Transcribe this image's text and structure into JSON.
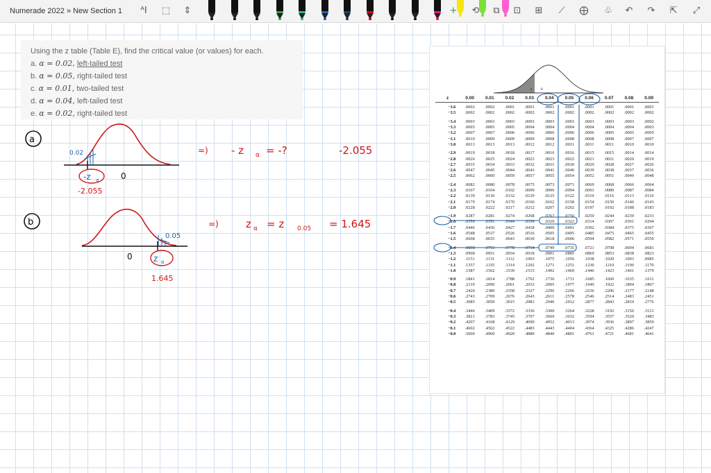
{
  "toolbar": {
    "breadcrumb": "Numerade 2022 » New Section 1",
    "tools": [
      "text-select-icon",
      "lasso-icon",
      "insert-space-icon",
      "eraser-icon",
      "plus-icon",
      "ink-to-shape-icon",
      "ink-to-text-icon",
      "ink-replay-icon",
      "ruler-icon",
      "math-icon",
      "tag-icon",
      "undo-icon",
      "redo-icon",
      "share-icon",
      "expand-icon"
    ],
    "pens": [
      {
        "name": "pen-black",
        "color": "#111111"
      },
      {
        "name": "pen-black-2",
        "color": "#111111"
      },
      {
        "name": "pen-black-3",
        "color": "#111111"
      },
      {
        "name": "pen-green",
        "color": "#2da44e"
      },
      {
        "name": "pen-teal",
        "color": "#1abc9c"
      },
      {
        "name": "pen-blue",
        "color": "#1f5fbf"
      },
      {
        "name": "pen-navy",
        "color": "#1d3f7a"
      },
      {
        "name": "pen-red",
        "color": "#d0021b"
      },
      {
        "name": "pen-black-4",
        "color": "#111111"
      },
      {
        "name": "pen-black-5",
        "color": "#111111"
      },
      {
        "name": "pen-magenta",
        "color": "#e6168b"
      },
      {
        "name": "pen-yellow-highlighter",
        "color": "#f5e50a"
      },
      {
        "name": "pen-green-highlighter",
        "color": "#7ddf3a"
      },
      {
        "name": "pen-pink-highlighter",
        "color": "#ff5dd0"
      }
    ]
  },
  "problem": {
    "intro": "Using the z table (Table E), find the critical value (or values) for each.",
    "items": [
      {
        "letter": "a.",
        "alpha": "α = 0.02,",
        "tail": "left-tailed test"
      },
      {
        "letter": "b.",
        "alpha": "α = 0.05,",
        "tail": "right-tailed test"
      },
      {
        "letter": "c.",
        "alpha": "α = 0.01,",
        "tail": "two-tailed test"
      },
      {
        "letter": "d.",
        "alpha": "α = 0.04,",
        "tail": "left-tailed test"
      },
      {
        "letter": "e.",
        "alpha": "α = 0.02,",
        "tail": "right-tailed test"
      }
    ]
  },
  "handwriting": {
    "part_a": {
      "label": "a",
      "tail_area": "0.02",
      "neg_z": "-z",
      "alpha_sub": "α",
      "zero": "0",
      "value_under": "-2.055",
      "arrow": "=)",
      "eq1": "- z",
      "eq1_tail": "= -?",
      "answer": "-2.055"
    },
    "part_b": {
      "label": "b",
      "tail_area": "0.05",
      "zero": "0",
      "z": "z",
      "alpha_sub": "α",
      "value_under": "1.645",
      "arrow": "=)",
      "eq": "z",
      "eq_mid": "= z",
      "sub_val": "0.05",
      "answer": "= 1.645"
    }
  },
  "ztable": {
    "curve_labels": [
      "z",
      "0"
    ],
    "headers": [
      "z",
      "0.00",
      "0.01",
      "0.02",
      "0.03",
      "0.04",
      "0.05",
      "0.06",
      "0.07",
      "0.08",
      "0.09"
    ],
    "groups": [
      [
        [
          "−3.6",
          ".0002",
          ".0002",
          ".0001",
          ".0001",
          ".0001",
          ".0001",
          ".0001",
          ".0001",
          ".0001",
          ".0001"
        ],
        [
          "−3.5",
          ".0002",
          ".0002",
          ".0002",
          ".0002",
          ".0002",
          ".0002",
          ".0002",
          ".0002",
          ".0002",
          ".0002"
        ]
      ],
      [
        [
          "−3.4",
          ".0003",
          ".0003",
          ".0003",
          ".0003",
          ".0003",
          ".0003",
          ".0003",
          ".0003",
          ".0003",
          ".0002"
        ],
        [
          "−3.3",
          ".0005",
          ".0005",
          ".0005",
          ".0004",
          ".0004",
          ".0004",
          ".0004",
          ".0004",
          ".0004",
          ".0003"
        ],
        [
          "−3.2",
          ".0007",
          ".0007",
          ".0006",
          ".0006",
          ".0006",
          ".0006",
          ".0006",
          ".0005",
          ".0005",
          ".0005"
        ],
        [
          "−3.1",
          ".0010",
          ".0009",
          ".0009",
          ".0009",
          ".0008",
          ".0008",
          ".0008",
          ".0008",
          ".0007",
          ".0007"
        ],
        [
          "−3.0",
          ".0013",
          ".0013",
          ".0013",
          ".0012",
          ".0012",
          ".0011",
          ".0011",
          ".0011",
          ".0010",
          ".0010"
        ]
      ],
      [
        [
          "−2.9",
          ".0019",
          ".0018",
          ".0018",
          ".0017",
          ".0016",
          ".0016",
          ".0015",
          ".0015",
          ".0014",
          ".0014"
        ],
        [
          "−2.8",
          ".0026",
          ".0025",
          ".0024",
          ".0023",
          ".0023",
          ".0022",
          ".0021",
          ".0021",
          ".0020",
          ".0019"
        ],
        [
          "−2.7",
          ".0035",
          ".0034",
          ".0033",
          ".0032",
          ".0031",
          ".0030",
          ".0029",
          ".0028",
          ".0027",
          ".0026"
        ],
        [
          "−2.6",
          ".0047",
          ".0045",
          ".0044",
          ".0043",
          ".0041",
          ".0040",
          ".0039",
          ".0038",
          ".0037",
          ".0036"
        ],
        [
          "−2.5",
          ".0062",
          ".0060",
          ".0059",
          ".0057",
          ".0055",
          ".0054",
          ".0052",
          ".0051",
          ".0049",
          ".0048"
        ]
      ],
      [
        [
          "−2.4",
          ".0082",
          ".0080",
          ".0078",
          ".0075",
          ".0073",
          ".0071",
          ".0069",
          ".0068",
          ".0066",
          ".0064"
        ],
        [
          "−2.3",
          ".0107",
          ".0104",
          ".0102",
          ".0099",
          ".0096",
          ".0094",
          ".0091",
          ".0089",
          ".0087",
          ".0084"
        ],
        [
          "−2.2",
          ".0139",
          ".0136",
          ".0132",
          ".0129",
          ".0125",
          ".0122",
          ".0119",
          ".0116",
          ".0113",
          ".0110"
        ],
        [
          "−2.1",
          ".0179",
          ".0174",
          ".0170",
          ".0166",
          ".0162",
          ".0158",
          ".0154",
          ".0150",
          ".0146",
          ".0143"
        ],
        [
          "−2.0",
          ".0228",
          ".0222",
          ".0217",
          ".0212",
          ".0207",
          ".0202",
          ".0197",
          ".0192",
          ".0188",
          ".0183"
        ]
      ],
      [
        [
          "−1.9",
          ".0287",
          ".0281",
          ".0274",
          ".0268",
          ".0262",
          ".0256",
          ".0250",
          ".0244",
          ".0239",
          ".0233"
        ],
        [
          "−1.8",
          ".0359",
          ".0351",
          ".0344",
          ".0336",
          ".0329",
          ".0322",
          ".0314",
          ".0307",
          ".0301",
          ".0294"
        ],
        [
          "−1.7",
          ".0446",
          ".0436",
          ".0427",
          ".0418",
          ".0409",
          ".0401",
          ".0392",
          ".0384",
          ".0375",
          ".0367"
        ],
        [
          "−1.6",
          ".0548",
          ".0537",
          ".0526",
          ".0516",
          ".0505",
          ".0495",
          ".0485",
          ".0475",
          ".0465",
          ".0455"
        ],
        [
          "−1.5",
          ".0668",
          ".0655",
          ".0643",
          ".0630",
          ".0618",
          ".0606",
          ".0594",
          ".0582",
          ".0571",
          ".0559"
        ]
      ],
      [
        [
          "−1.4",
          ".0808",
          ".0793",
          ".0778",
          ".0764",
          ".0749",
          ".0735",
          ".0721",
          ".0708",
          ".0694",
          ".0681"
        ],
        [
          "−1.3",
          ".0968",
          ".0951",
          ".0934",
          ".0918",
          ".0901",
          ".0885",
          ".0869",
          ".0853",
          ".0838",
          ".0823"
        ],
        [
          "−1.2",
          ".1151",
          ".1131",
          ".1112",
          ".1093",
          ".1075",
          ".1056",
          ".1038",
          ".1020",
          ".1003",
          ".0985"
        ],
        [
          "−1.1",
          ".1357",
          ".1335",
          ".1314",
          ".1292",
          ".1271",
          ".1251",
          ".1230",
          ".1210",
          ".1190",
          ".1170"
        ],
        [
          "−1.0",
          ".1587",
          ".1562",
          ".1539",
          ".1515",
          ".1492",
          ".1469",
          ".1446",
          ".1423",
          ".1401",
          ".1379"
        ]
      ],
      [
        [
          "−0.9",
          ".1841",
          ".1814",
          ".1788",
          ".1762",
          ".1736",
          ".1711",
          ".1685",
          ".1660",
          ".1635",
          ".1611"
        ],
        [
          "−0.8",
          ".2119",
          ".2090",
          ".2061",
          ".2033",
          ".2005",
          ".1977",
          ".1949",
          ".1922",
          ".1894",
          ".1867"
        ],
        [
          "−0.7",
          ".2420",
          ".2389",
          ".2358",
          ".2327",
          ".2296",
          ".2266",
          ".2236",
          ".2206",
          ".2177",
          ".2148"
        ],
        [
          "−0.6",
          ".2743",
          ".2709",
          ".2676",
          ".2643",
          ".2611",
          ".2578",
          ".2546",
          ".2514",
          ".2483",
          ".2451"
        ],
        [
          "−0.5",
          ".3085",
          ".3050",
          ".3015",
          ".2981",
          ".2946",
          ".2912",
          ".2877",
          ".2843",
          ".2810",
          ".2776"
        ]
      ],
      [
        [
          "−0.4",
          ".3446",
          ".3409",
          ".3372",
          ".3336",
          ".3300",
          ".3264",
          ".3228",
          ".3192",
          ".3156",
          ".3121"
        ],
        [
          "−0.3",
          ".3821",
          ".3783",
          ".3745",
          ".3707",
          ".3669",
          ".3632",
          ".3594",
          ".3557",
          ".3520",
          ".3483"
        ],
        [
          "−0.2",
          ".4207",
          ".4168",
          ".4129",
          ".4090",
          ".4052",
          ".4013",
          ".3974",
          ".3936",
          ".3897",
          ".3859"
        ],
        [
          "−0.1",
          ".4602",
          ".4562",
          ".4522",
          ".4483",
          ".4443",
          ".4404",
          ".4364",
          ".4325",
          ".4286",
          ".4247"
        ],
        [
          "−0.0",
          ".5000",
          ".4960",
          ".4920",
          ".4880",
          ".4840",
          ".4801",
          ".4761",
          ".4721",
          ".4681",
          ".4641"
        ]
      ]
    ]
  }
}
